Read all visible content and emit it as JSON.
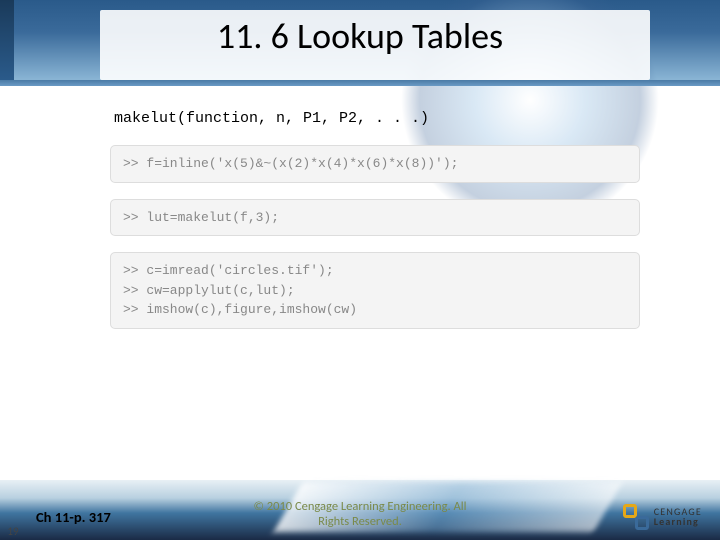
{
  "title": "11. 6 Lookup Tables",
  "fn_signature": "makelut(function, n, P1, P2, . . .)",
  "code": {
    "box1": ">> f=inline('x(5)&~(x(2)*x(4)*x(6)*x(8))');",
    "box2": ">> lut=makelut(f,3);",
    "box3": ">> c=imread('circles.tif');\n>> cw=applylut(c,lut);\n>> imshow(c),figure,imshow(cw)"
  },
  "footer": {
    "page_num": "19",
    "chapter": "Ch 11-p. 317",
    "copyright_l1": "© 2010 Cengage Learning Engineering. All",
    "copyright_l2": "Rights Reserved.",
    "logo_l1": "CENGAGE",
    "logo_l2": "Learning"
  }
}
